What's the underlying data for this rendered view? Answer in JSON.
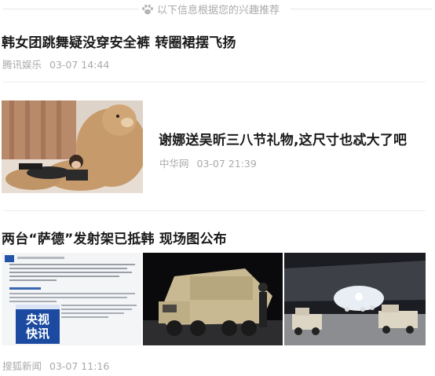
{
  "header": {
    "label": "以下信息根据您的兴趣推荐",
    "icon": "paw-icon"
  },
  "feed": [
    {
      "title": "韩女团跳舞疑没穿安全裤 转圈裙摆飞扬",
      "source": "腾讯娱乐",
      "time": "03-07 14:44"
    },
    {
      "title": "谢娜送吴昕三八节礼物,这尺寸也忒大了吧",
      "source": "中华网",
      "time": "03-07 21:39",
      "image": "teddy-bear-photo"
    },
    {
      "title": "两台“萨德”发射架已抵韩 现场图公布",
      "source": "搜狐新闻",
      "time": "03-07 11:16",
      "images": [
        "news-screenshot-cctv",
        "thaad-launcher-truck-photo",
        "aircraft-unloading-photo"
      ],
      "cctv_badge": [
        "央视",
        "快讯"
      ]
    }
  ],
  "colors": {
    "title": "#1a1a1a",
    "meta": "#aaaaaa",
    "divider": "#eeeeee",
    "cctv_blue": "#1b4aa0"
  }
}
